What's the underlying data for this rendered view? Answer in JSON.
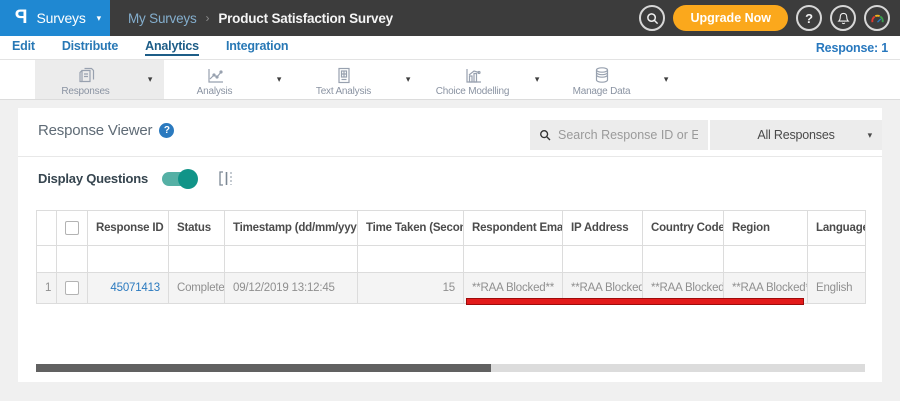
{
  "topbar": {
    "logo": "P",
    "app_menu": "Surveys",
    "menu_caret": "▾",
    "breadcrumb": {
      "parent": "My Surveys",
      "separator": "›",
      "current": "Product Satisfaction Survey"
    },
    "upgrade_label": "Upgrade Now",
    "help_label": "?"
  },
  "nav": {
    "items": [
      {
        "label": "Edit",
        "active": false
      },
      {
        "label": "Distribute",
        "active": false
      },
      {
        "label": "Analytics",
        "active": true
      },
      {
        "label": "Integration",
        "active": false
      }
    ],
    "response_count": "Response: 1"
  },
  "toolbar": {
    "caret": "▾",
    "items": [
      {
        "label": "Responses",
        "icon": "responses-icon",
        "active": true
      },
      {
        "label": "Analysis",
        "icon": "analysis-icon",
        "active": false
      },
      {
        "label": "Text Analysis",
        "icon": "text-analysis-icon",
        "active": false
      },
      {
        "label": "Choice Modelling",
        "icon": "choice-modelling-icon",
        "active": false
      },
      {
        "label": "Manage Data",
        "icon": "manage-data-icon",
        "active": false
      }
    ]
  },
  "viewer": {
    "title": "Response Viewer",
    "help_glyph": "?",
    "search_placeholder": "Search Response ID or Email",
    "filter_dropdown": "All Responses",
    "filter_caret": "▾",
    "display_questions_label": "Display Questions",
    "display_questions_on": true
  },
  "table": {
    "sort_desc_glyph": "▼",
    "sort_both_glyph": "↕",
    "columns": [
      {
        "label": "Response ID",
        "sort": "desc"
      },
      {
        "label": "Status",
        "sort": "none"
      },
      {
        "label": "Timestamp (dd/mm/yyyy)",
        "sort": "both"
      },
      {
        "label": "Time Taken (Seconds)",
        "sort": "both"
      },
      {
        "label": "Respondent Email",
        "sort": "none"
      },
      {
        "label": "IP Address",
        "sort": "none"
      },
      {
        "label": "Country Code",
        "sort": "none"
      },
      {
        "label": "Region",
        "sort": "none"
      },
      {
        "label": "Language",
        "sort": "none"
      }
    ],
    "rows": [
      {
        "num": "1",
        "response_id": "45071413",
        "status": "Completed",
        "timestamp": "09/12/2019 13:12:45",
        "time_taken": "15",
        "respondent_email": "**RAA Blocked**",
        "ip_address": "**RAA Blocked**",
        "country_code": "**RAA Blocked**",
        "region": "**RAA Blocked**",
        "language": "English"
      }
    ]
  },
  "icons": {
    "search-icon": "magnifier",
    "bell-icon": "notification bell",
    "avatar-gauge-icon": "colorful dashboard gauge",
    "responses-icon": "document stack",
    "analysis-icon": "line chart",
    "text-analysis-icon": "document with table",
    "choice-modelling-icon": "bars with trend line",
    "manage-data-icon": "database cylinder",
    "freeze-columns-icon": "bracket with solid and dotted bars"
  },
  "colors": {
    "brand_blue": "#1f88d2",
    "link_blue": "#2878be",
    "upgrade_orange": "#fba81c",
    "toggle_teal": "#119488",
    "annotation_red": "#e31b1b",
    "topbar_gray": "#3c3c3c"
  }
}
